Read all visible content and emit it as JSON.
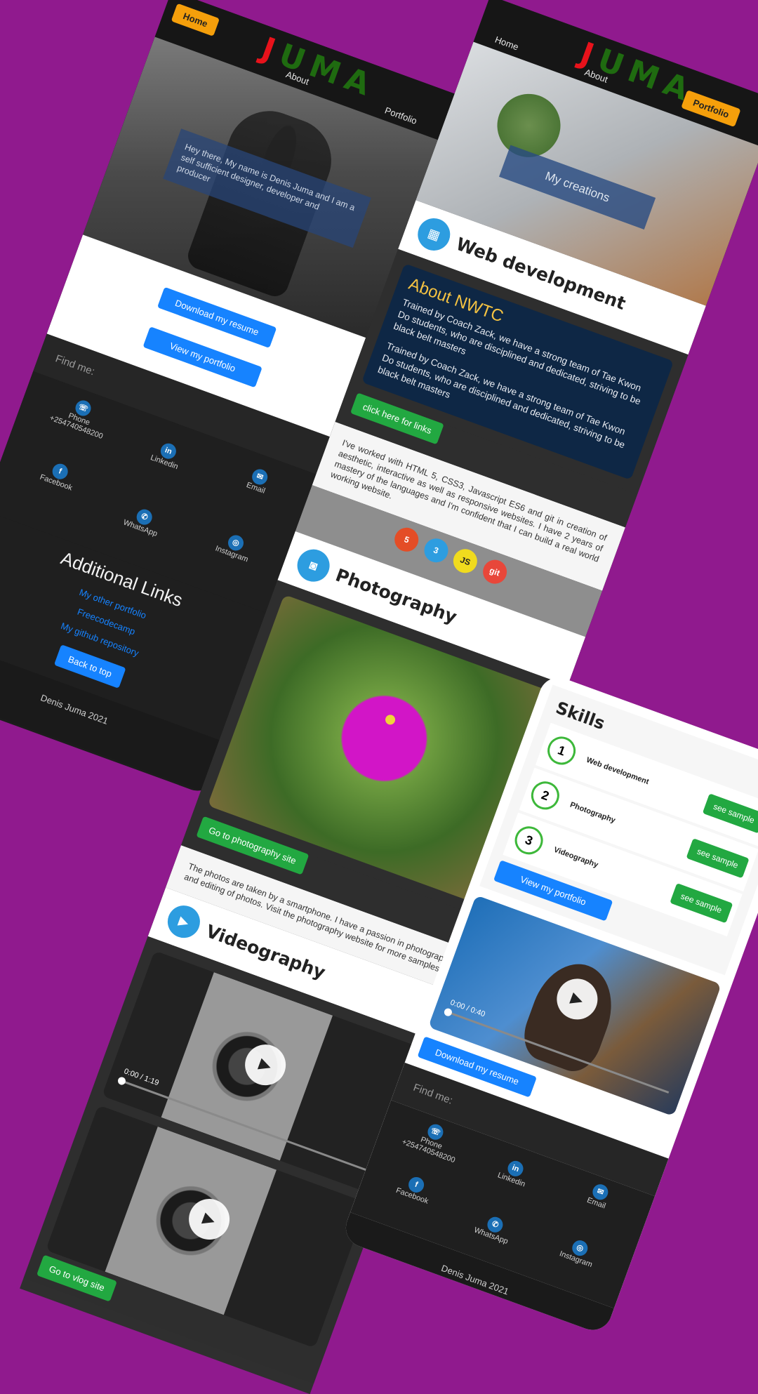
{
  "brand": {
    "logo_j": "J",
    "logo_rest": "UMA"
  },
  "nav": {
    "home": "Home",
    "about": "About",
    "portfolio": "Portfolio"
  },
  "home_page": {
    "intro": "Hey there, My name is Denis Juma and I am a self sufficient designer, developer and producer",
    "download_resume": "Download my resume",
    "view_portfolio": "View my portfolio",
    "find_me": "Find me:",
    "contacts": {
      "phone_label": "Phone",
      "phone_number": "+254740548200",
      "linkedin": "Linkedin",
      "email": "Email",
      "facebook": "Facebook",
      "whatsapp": "WhatsApp",
      "instagram": "Instagram"
    },
    "additional_links_title": "Additional Links",
    "links": [
      "My other portfolio",
      "Freecodecamp",
      "My github repository"
    ],
    "back_to_top": "Back to top",
    "footer": "Denis Juma 2021"
  },
  "portfolio_page": {
    "hero_caption": "My creations",
    "web_dev_title": "Web development",
    "about_title": "About NWTC",
    "about_para1": "Trained by Coach Zack, we have a strong team of Tae Kwon Do students, who are disciplined and dedicated, striving to be black belt masters",
    "about_para2": "Trained by Coach Zack, we have a strong team of Tae Kwon Do students, who are disciplined and dedicated, striving to be black belt masters",
    "links_button": "click here for links",
    "web_dev_text": "I've worked with HTML 5, CSS3, Javascript ES6 and git in creation of aesthetic, interactive as well as responsive websites. I have 2 years of mastery of the languages and I'm confident that I can build a real world working website.",
    "tech_icons": [
      "5",
      "3",
      "JS",
      "git"
    ],
    "photography_title": "Photography",
    "photography_button": "Go to photography site",
    "photography_text": "The photos are taken by a smartphone. I have a passion in photography and editing of photos. Visit the photography website for more samples.",
    "videography_title": "Videography",
    "video_time": "0:00 / 1:19",
    "vlog_button": "Go to vlog site"
  },
  "about_page": {
    "skills_title": "Skills",
    "skills": [
      {
        "num": "1",
        "name": "Web development",
        "action": "see sample"
      },
      {
        "num": "2",
        "name": "Photography",
        "action": "see sample"
      },
      {
        "num": "3",
        "name": "Videography",
        "action": "see sample"
      }
    ],
    "view_portfolio": "View my portfolio",
    "video_time": "0:00 / 0:40",
    "download_resume": "Download my resume",
    "find_me": "Find me:",
    "footer": "Denis Juma 2021"
  },
  "colors": {
    "background": "#901a8e",
    "accent_orange": "#f59f0b",
    "primary_blue": "#1683ff",
    "success_green": "#22a841"
  }
}
